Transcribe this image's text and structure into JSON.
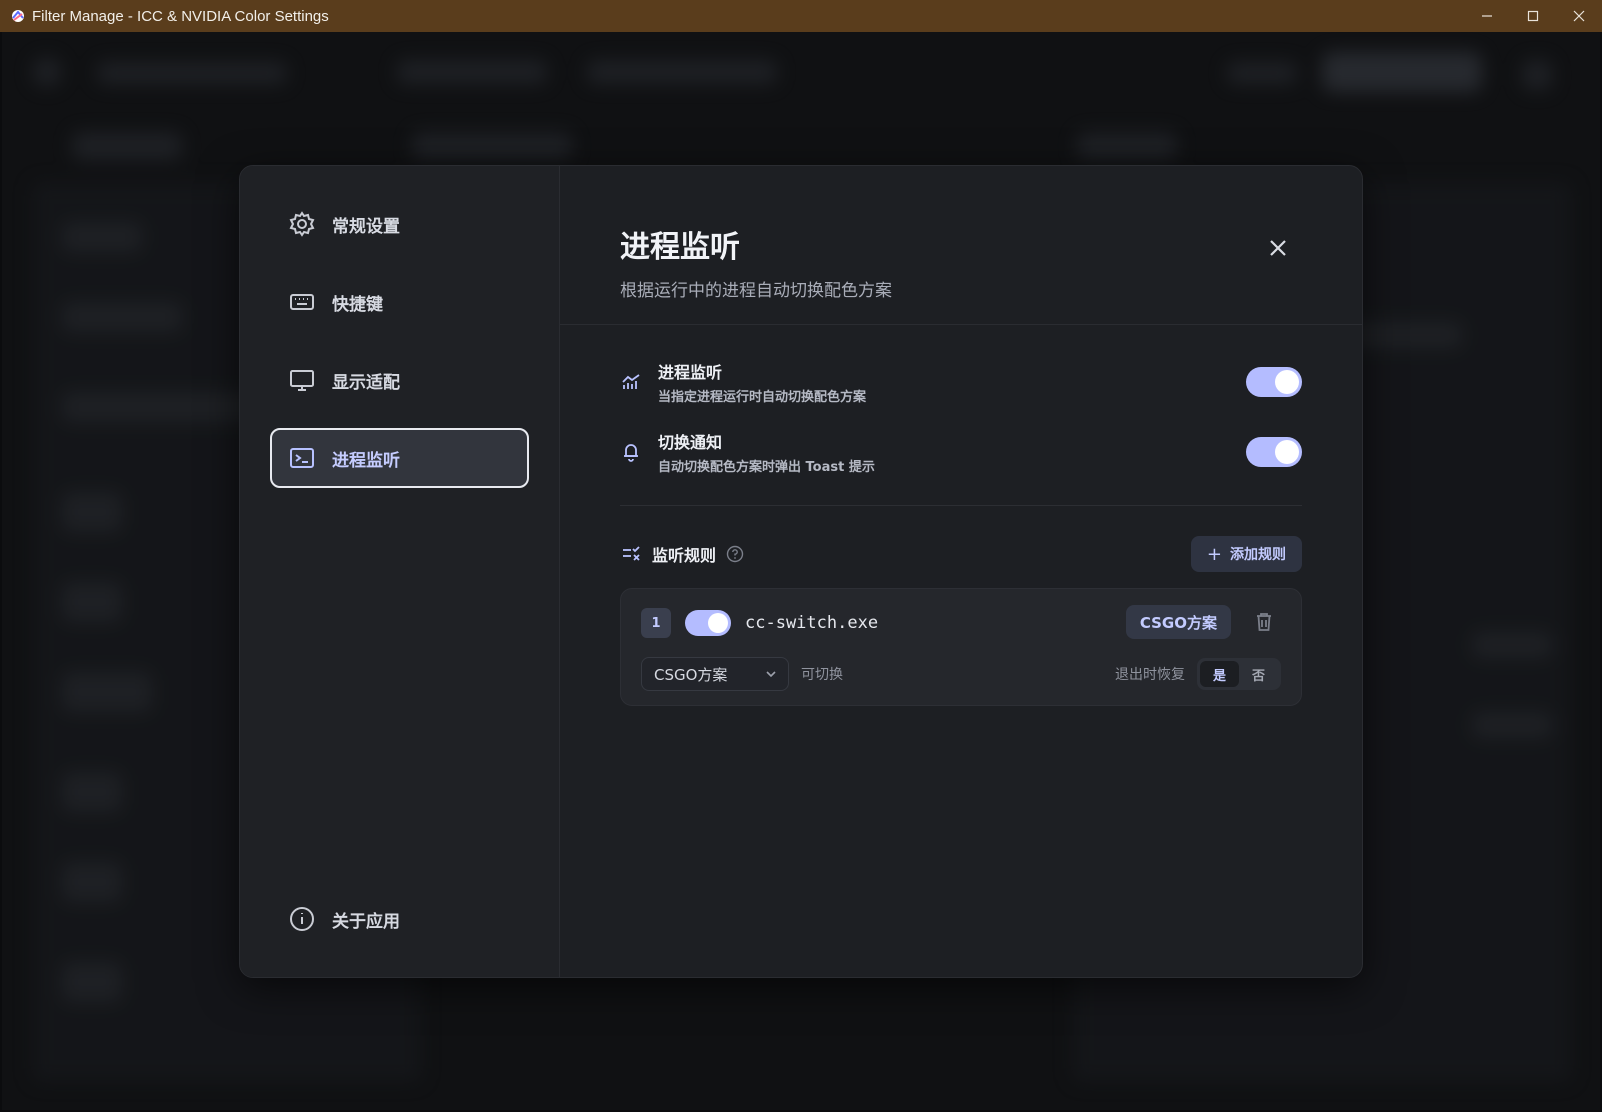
{
  "window": {
    "title": "Filter Manage - ICC & NVIDIA Color Settings"
  },
  "sidebar": {
    "items": [
      {
        "label": "常规设置",
        "icon": "gear-icon",
        "active": false
      },
      {
        "label": "快捷键",
        "icon": "keyboard-icon",
        "active": false
      },
      {
        "label": "显示适配",
        "icon": "monitor-icon",
        "active": false
      },
      {
        "label": "进程监听",
        "icon": "terminal-icon",
        "active": true
      }
    ],
    "about": {
      "label": "关于应用",
      "icon": "info-icon"
    }
  },
  "panel": {
    "title": "进程监听",
    "subtitle": "根据运行中的进程自动切换配色方案"
  },
  "settings": [
    {
      "title": "进程监听",
      "desc": "当指定进程运行时自动切换配色方案",
      "icon": "chart-icon",
      "enabled": true
    },
    {
      "title": "切换通知",
      "desc": "自动切换配色方案时弹出 Toast 提示",
      "icon": "bell-icon",
      "enabled": true
    }
  ],
  "rules": {
    "title": "监听规则",
    "add_label": "添加规则",
    "items": [
      {
        "index": "1",
        "enabled": true,
        "process": "cc-switch.exe",
        "badge": "CSGO方案",
        "scheme": "CSGO方案",
        "switchable": "可切换",
        "restore_label": "退出时恢复",
        "restore_yes": "是",
        "restore_no": "否",
        "restore_selected": "是"
      }
    ]
  },
  "colors": {
    "accent": "#b4bcff",
    "titlebar": "#5a3d1c",
    "modal_bg": "#1d1f23"
  }
}
